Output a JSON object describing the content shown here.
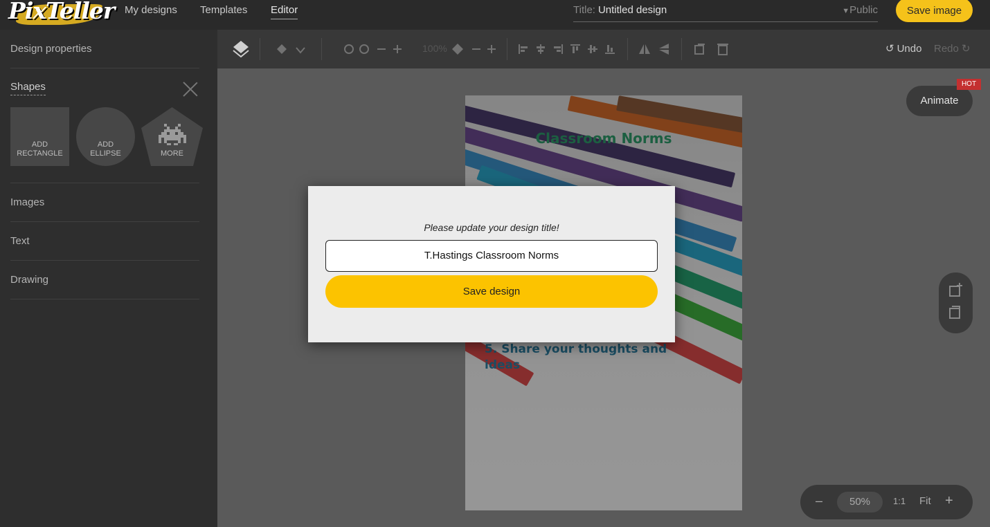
{
  "app": {
    "logo_text": "PixTeller",
    "nav": [
      {
        "label": "My designs"
      },
      {
        "label": "Templates"
      },
      {
        "label": "Editor",
        "active": true
      }
    ],
    "title_label": "Title:",
    "title_value": "Untitled design",
    "visibility": "Public",
    "save_image_label": "Save image"
  },
  "sidebar": {
    "design_properties": "Design properties",
    "shapes_label": "Shapes",
    "shape_tiles": [
      {
        "line1": "ADD",
        "line2": "RECTANGLE"
      },
      {
        "line1": "ADD",
        "line2": "ELLIPSE"
      },
      {
        "line1": "MORE",
        "line2": ""
      }
    ],
    "sections": [
      "Images",
      "Text",
      "Drawing"
    ]
  },
  "toolbar": {
    "zoom_value": "100%",
    "undo_label": "Undo",
    "redo_label": "Redo"
  },
  "canvas": {
    "title": "Classroom Norms",
    "body_line1": "5. Share your thoughts and",
    "body_line2": "ideas"
  },
  "animate": {
    "label": "Animate",
    "badge": "HOT"
  },
  "zoombar": {
    "pct": "50%",
    "one_to_one": "1:1",
    "fit": "Fit"
  },
  "modal": {
    "prompt": "Please update your design title!",
    "input_value": "T.Hastings Classroom Norms",
    "save_label": "Save design"
  },
  "colors": {
    "accent": "#fcc300",
    "topbar": "#2a2a2a",
    "panel": "#2e2e2e",
    "workspace": "#5a5a5a"
  }
}
